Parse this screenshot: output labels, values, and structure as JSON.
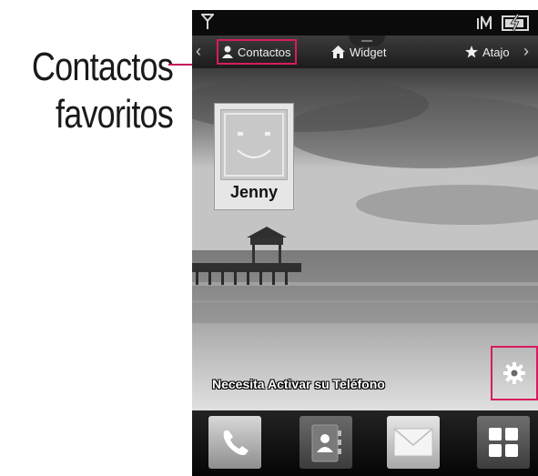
{
  "callout": {
    "label_line1": "Contactos",
    "label_line2": "favoritos",
    "accent_color": "#d81b60"
  },
  "status_bar": {
    "icons": [
      "signal-icon",
      "network-icon",
      "battery-icon"
    ]
  },
  "tabs": [
    {
      "label": "Contactos",
      "icon": "person-icon"
    },
    {
      "label": "Widget",
      "icon": "home-icon"
    },
    {
      "label": "Atajo",
      "icon": "star-icon"
    }
  ],
  "favorite_contact": {
    "name": "Jenny"
  },
  "notice": "Necesita Activar su Teléfono",
  "dock": {
    "items": [
      "phone-icon",
      "contacts-icon",
      "message-icon",
      "menu-grid-icon"
    ]
  },
  "colors": {
    "highlight": "#d81b60",
    "statusbar": "#0b0b0b",
    "dock": "#111111"
  }
}
